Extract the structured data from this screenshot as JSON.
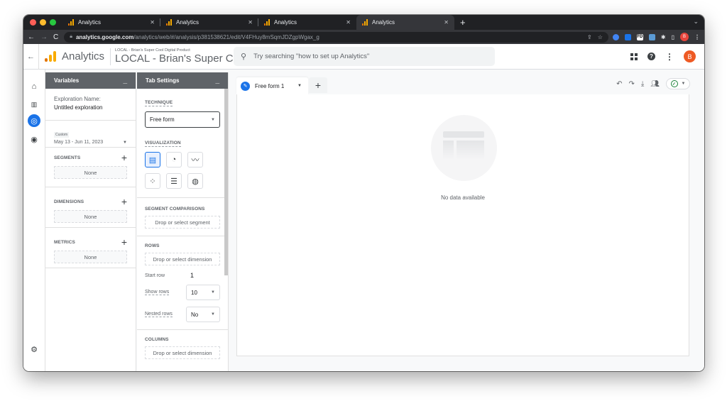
{
  "browser": {
    "tabs": [
      {
        "title": "Analytics",
        "active": false
      },
      {
        "title": "Analytics",
        "active": false
      },
      {
        "title": "Analytics",
        "active": false
      },
      {
        "title": "Analytics",
        "active": true
      }
    ],
    "new_tab_label": "+",
    "url_host": "analytics.google.com",
    "url_path": "/analytics/web/#/analysis/p381538621/edit/V4FHuy8mSqmJDZgpWgax_g",
    "profile_initial": "B",
    "extensions": [
      "extension-1",
      "extension-2",
      "FD",
      "extension-on",
      "puzzle"
    ]
  },
  "header": {
    "brand": "Analytics",
    "property_account": "LOCAL - Brian's Super Cool Digital Product",
    "property_name": "LOCAL - Brian's Super Cool ...",
    "search_placeholder": "Try searching \"how to set up Analytics\"",
    "account_initial": "B",
    "brand_colors": [
      "#e37400",
      "#f9ab00"
    ]
  },
  "leftnav": {
    "items": [
      {
        "name": "home",
        "active": false
      },
      {
        "name": "reports",
        "active": false
      },
      {
        "name": "explore",
        "active": true
      },
      {
        "name": "advertising",
        "active": false
      }
    ],
    "settings": "admin"
  },
  "variables": {
    "title": "Variables",
    "exploration_name_label": "Exploration Name:",
    "exploration_name_value": "Untitled exploration",
    "date_chip": "Custom",
    "date_range": "May 13 - Jun 11, 2023",
    "segments_label": "SEGMENTS",
    "segments_value": "None",
    "dimensions_label": "DIMENSIONS",
    "dimensions_value": "None",
    "metrics_label": "METRICS",
    "metrics_value": "None"
  },
  "tab_settings": {
    "title": "Tab Settings",
    "technique_label": "TECHNIQUE",
    "technique_value": "Free form",
    "visualization_label": "VISUALIZATION",
    "visualizations": [
      "table",
      "donut-chart",
      "line-chart",
      "scatter-plot",
      "bar-chart",
      "geo-map"
    ],
    "selected_visualization": "table",
    "segment_comparisons_label": "SEGMENT COMPARISONS",
    "segment_comparisons_placeholder": "Drop or select segment",
    "rows_label": "ROWS",
    "rows_placeholder": "Drop or select dimension",
    "start_row_label": "Start row",
    "start_row_value": "1",
    "show_rows_label": "Show rows",
    "show_rows_value": "10",
    "nested_rows_label": "Nested rows",
    "nested_rows_value": "No",
    "columns_label": "COLUMNS",
    "columns_placeholder": "Drop or select dimension"
  },
  "canvas": {
    "sheet_tab": "Free form 1",
    "add_tab": "+",
    "empty_message": "No data available",
    "status": "ok"
  }
}
